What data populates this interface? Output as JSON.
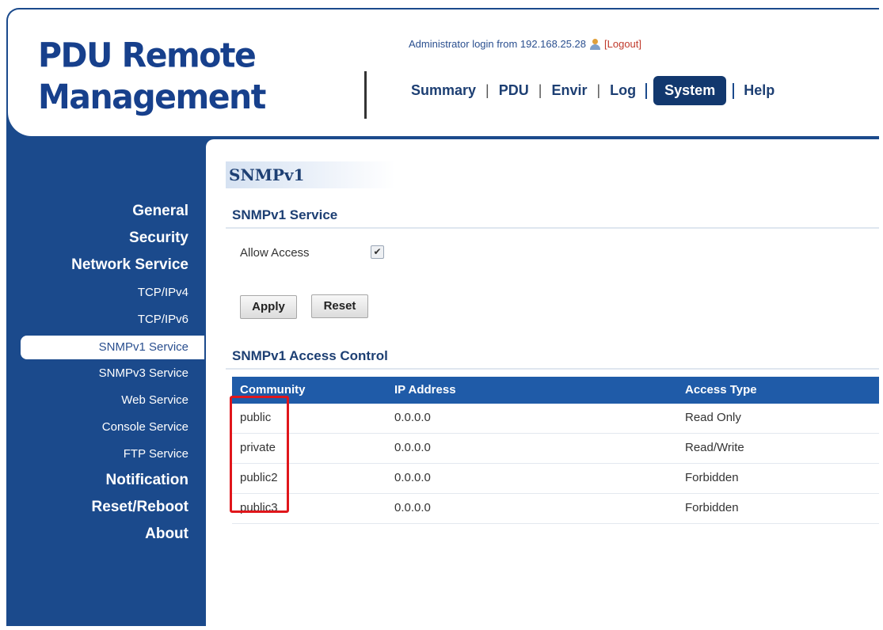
{
  "header": {
    "logo_line1": "PDU Remote",
    "logo_line2": "Management",
    "login_text": "Administrator login from 192.168.25.28",
    "logout_label": "[Logout]",
    "nav": [
      {
        "label": "Summary"
      },
      {
        "label": "PDU"
      },
      {
        "label": "Envir"
      },
      {
        "label": "Log"
      },
      {
        "label": "System",
        "active": true
      },
      {
        "label": "Help"
      }
    ],
    "nav_separator": "|"
  },
  "sidebar": {
    "items": [
      {
        "label": "General"
      },
      {
        "label": "Security"
      },
      {
        "label": "Network Service"
      },
      {
        "label": "TCP/IPv4"
      },
      {
        "label": "TCP/IPv6"
      },
      {
        "label": "SNMPv1 Service",
        "active": true
      },
      {
        "label": "SNMPv3 Service"
      },
      {
        "label": "Web Service"
      },
      {
        "label": "Console Service"
      },
      {
        "label": "FTP Service"
      },
      {
        "label": "Notification"
      },
      {
        "label": "Reset/Reboot"
      },
      {
        "label": "About"
      }
    ]
  },
  "main": {
    "page_title": "SNMPv1",
    "service_section": "SNMPv1 Service",
    "allow_access_label": "Allow Access",
    "allow_access_checked": "✔",
    "apply_label": "Apply",
    "reset_label": "Reset",
    "access_section": "SNMPv1 Access Control",
    "table": {
      "columns": [
        "Community",
        "IP Address",
        "Access Type"
      ],
      "rows": [
        [
          "public",
          "0.0.0.0",
          "Read Only"
        ],
        [
          "private",
          "0.0.0.0",
          "Read/Write"
        ],
        [
          "public2",
          "0.0.0.0",
          "Forbidden"
        ],
        [
          "public3",
          "0.0.0.0",
          "Forbidden"
        ]
      ]
    }
  },
  "colors": {
    "brand_blue": "#1b4a8c",
    "table_header": "#1f5ba8",
    "highlight_red": "#e0161b"
  },
  "icons": {
    "user": "user-icon",
    "check": "checkmark-icon"
  }
}
